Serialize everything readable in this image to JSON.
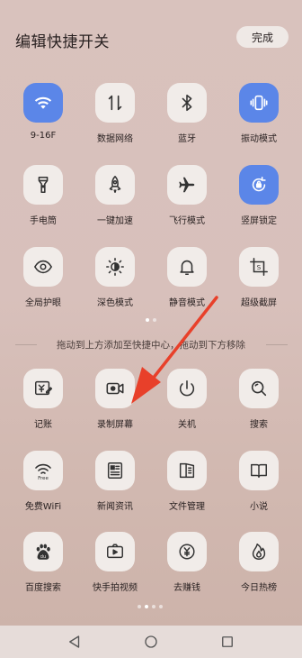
{
  "header": {
    "title": "编辑快捷开关",
    "done_label": "完成"
  },
  "active_color": "#5b86e8",
  "page1": [
    {
      "label": "9-16F",
      "icon": "wifi-icon",
      "active": true
    },
    {
      "label": "数据网络",
      "icon": "mobile-data-icon",
      "active": false
    },
    {
      "label": "蓝牙",
      "icon": "bluetooth-icon",
      "active": false
    },
    {
      "label": "振动模式",
      "icon": "vibrate-icon",
      "active": true
    },
    {
      "label": "手电筒",
      "icon": "flashlight-icon",
      "active": false
    },
    {
      "label": "一键加速",
      "icon": "rocket-icon",
      "active": false
    },
    {
      "label": "飞行模式",
      "icon": "airplane-icon",
      "active": false
    },
    {
      "label": "竖屏锁定",
      "icon": "rotation-lock-icon",
      "active": true
    },
    {
      "label": "全局护眼",
      "icon": "eye-icon",
      "active": false
    },
    {
      "label": "深色模式",
      "icon": "dark-mode-icon",
      "active": false
    },
    {
      "label": "静音模式",
      "icon": "bell-icon",
      "active": false
    },
    {
      "label": "超级截屏",
      "icon": "screenshot-icon",
      "active": false
    }
  ],
  "divider_text": "拖动到上方添加至快捷中心，拖动到下方移除",
  "page2": [
    {
      "label": "记账",
      "icon": "ledger-icon"
    },
    {
      "label": "录制屏幕",
      "icon": "screen-record-icon"
    },
    {
      "label": "关机",
      "icon": "power-icon"
    },
    {
      "label": "搜索",
      "icon": "search-icon"
    },
    {
      "label": "免费WiFi",
      "icon": "free-wifi-icon"
    },
    {
      "label": "新闻资讯",
      "icon": "news-icon"
    },
    {
      "label": "文件管理",
      "icon": "file-manager-icon"
    },
    {
      "label": "小说",
      "icon": "book-icon"
    },
    {
      "label": "百度搜索",
      "icon": "baidu-icon"
    },
    {
      "label": "快手拍视频",
      "icon": "video-capture-icon"
    },
    {
      "label": "去赚钱",
      "icon": "coin-icon"
    },
    {
      "label": "今日热榜",
      "icon": "flame-icon"
    }
  ],
  "free_wifi_badge": "Free",
  "baidu_badge": "du",
  "screenshot_glyph": "S",
  "navigation": {
    "back": "back-icon",
    "home": "home-icon",
    "recents": "recents-icon"
  }
}
